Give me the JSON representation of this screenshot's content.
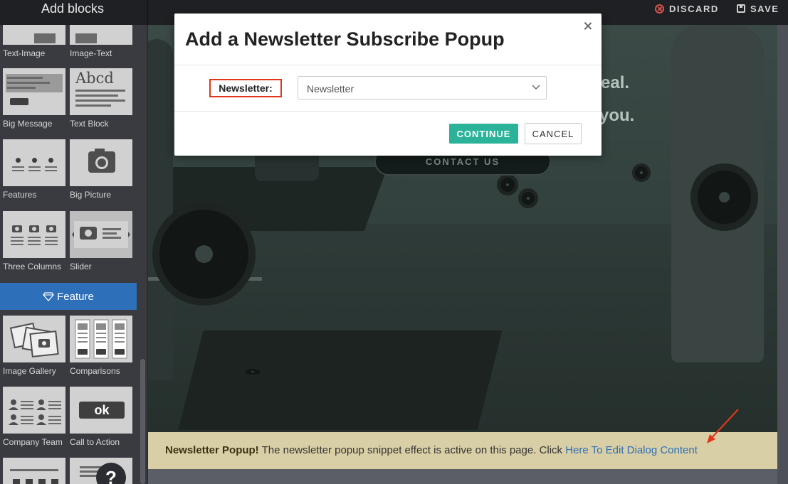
{
  "sidebar": {
    "title": "Add blocks",
    "category": "Feature",
    "blocks_top": [
      {
        "label": "Text-Image"
      },
      {
        "label": "Image-Text"
      },
      {
        "label": "Big Message"
      },
      {
        "label": "Text Block"
      },
      {
        "label": "Features"
      },
      {
        "label": "Big Picture"
      },
      {
        "label": "Three Columns"
      },
      {
        "label": "Slider"
      }
    ],
    "blocks_feature": [
      {
        "label": "Image Gallery"
      },
      {
        "label": "Comparisons"
      },
      {
        "label": "Company Team"
      },
      {
        "label": "Call to Action"
      }
    ],
    "thumb_text_block": "Abcd",
    "thumb_call_to_action": "ok",
    "help_glyph": "?"
  },
  "toolbar": {
    "discard_label": "DISCARD",
    "save_label": "SAVE"
  },
  "hero": {
    "line1": "eal.",
    "line2": "you.",
    "contact_button": "CONTACT US"
  },
  "notice": {
    "bold": "Newsletter Popup!",
    "text": " The newsletter popup snippet effect is active on this page. Click ",
    "link": "Here To Edit Dialog Content"
  },
  "modal": {
    "title": "Add a Newsletter Subscribe Popup",
    "field_label": "Newsletter:",
    "select_value": "Newsletter",
    "continue_label": "CONTINUE",
    "cancel_label": "CANCEL"
  },
  "colors": {
    "accent_blue": "#2d6fb8",
    "continue_green": "#2bb39a",
    "highlight_red": "#e1361b",
    "discard_red": "#d9534f"
  }
}
